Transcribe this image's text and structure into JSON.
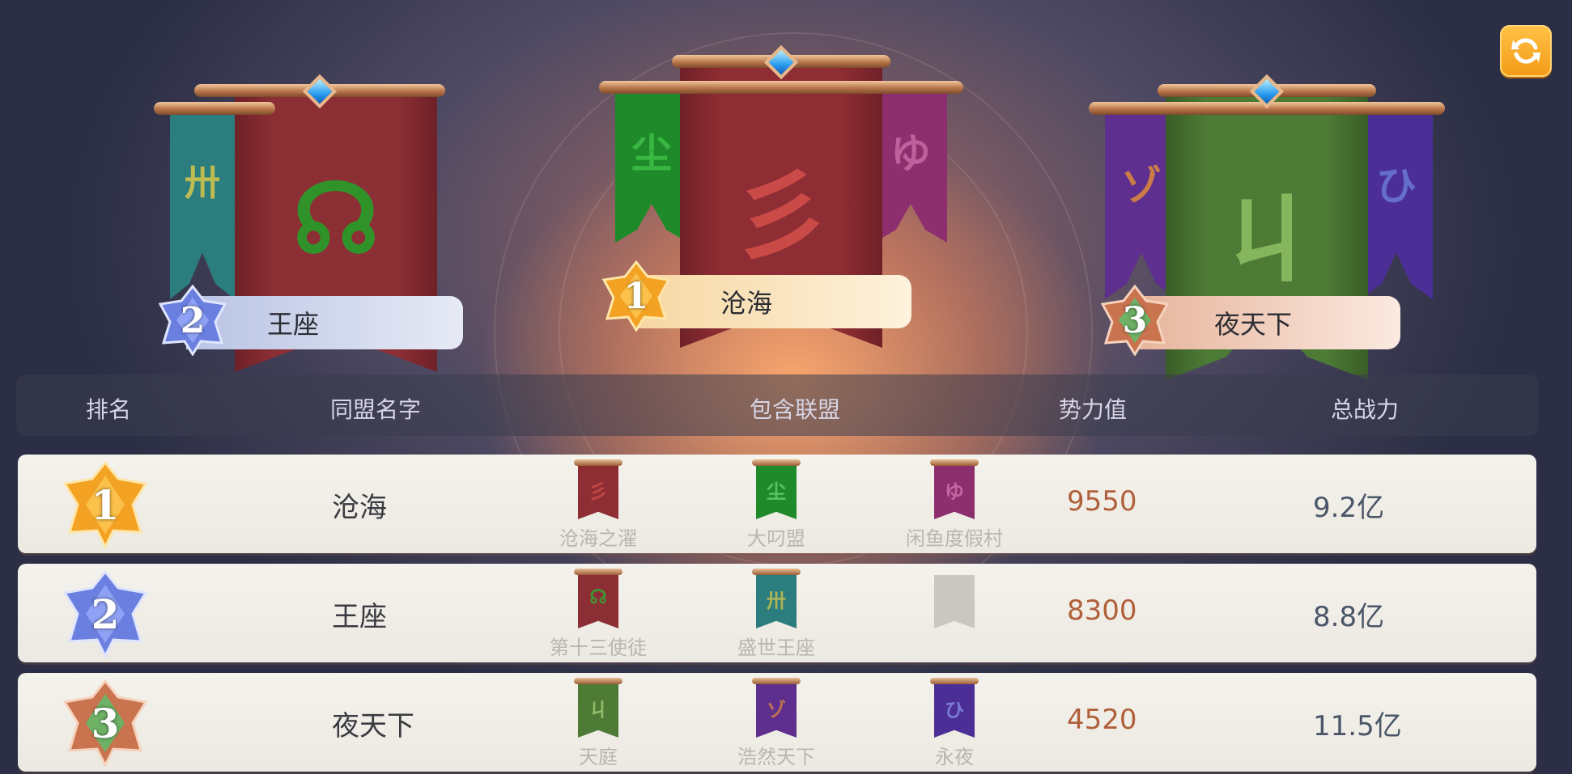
{
  "refresh_icon": "refresh-icon",
  "podium": [
    {
      "rank": "2",
      "name": "王座",
      "main_color": "#8c2f35",
      "glyph": "☊"
    },
    {
      "rank": "1",
      "name": "沧海",
      "main_color": "#8e2d33",
      "glyph": "彡"
    },
    {
      "rank": "3",
      "name": "夜天下",
      "main_color": "#4d7a35",
      "glyph": "ㄐ"
    }
  ],
  "table": {
    "headers": {
      "rank": "排名",
      "alliance_name": "同盟名字",
      "members": "包含联盟",
      "power": "势力值",
      "total": "总战力"
    },
    "rows": [
      {
        "rank": "1",
        "name": "沧海",
        "power": "9550",
        "total": "9.2亿",
        "members": [
          {
            "name": "沧海之濯",
            "color": "#8e2d33",
            "glyph": "彡"
          },
          {
            "name": "大叼盟",
            "color": "#1f8a2a",
            "glyph": "尘"
          },
          {
            "name": "闲鱼度假村",
            "color": "#8d2f6e",
            "glyph": "ゆ"
          }
        ]
      },
      {
        "rank": "2",
        "name": "王座",
        "power": "8300",
        "total": "8.8亿",
        "members": [
          {
            "name": "第十三使徒",
            "color": "#8c2f35",
            "glyph": "☊"
          },
          {
            "name": "盛世王座",
            "color": "#2c7d7e",
            "glyph": "卅"
          },
          {
            "name": "",
            "color": "#c9c7c2",
            "glyph": ""
          }
        ]
      },
      {
        "rank": "3",
        "name": "夜天下",
        "power": "4520",
        "total": "11.5亿",
        "members": [
          {
            "name": "天庭",
            "color": "#4d7a35",
            "glyph": "ㄐ"
          },
          {
            "name": "浩然天下",
            "color": "#5e2f8e",
            "glyph": "ゾ"
          },
          {
            "name": "永夜",
            "color": "#4b2f96",
            "glyph": "ひ"
          }
        ]
      }
    ]
  },
  "colors": {
    "gold_rank": "#f7a829",
    "silver_rank": "#7c8ee6",
    "bronze_rank": "#c9734f",
    "power_text": "#b0603a",
    "header_bar": "#3a3c4e"
  }
}
